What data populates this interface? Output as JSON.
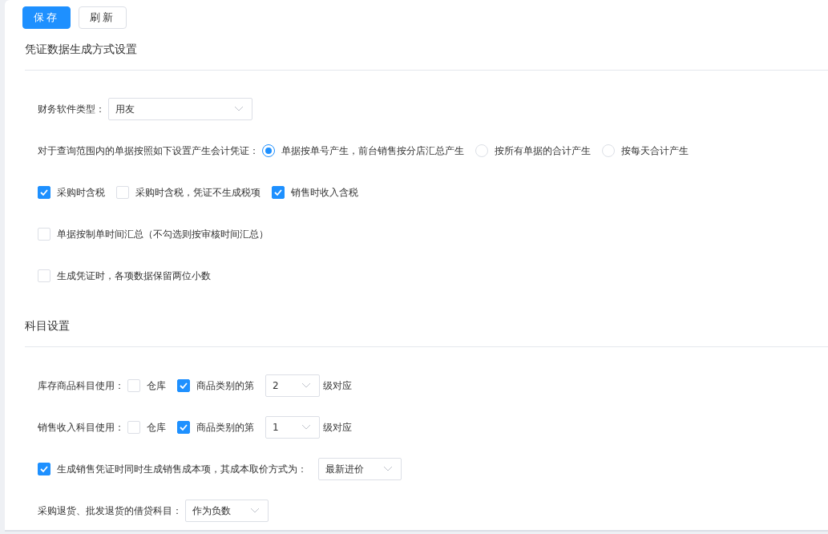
{
  "toolbar": {
    "buttons": [
      {
        "label": "保存",
        "kind": "primary"
      },
      {
        "label": "刷新",
        "kind": "default"
      }
    ]
  },
  "sections": [
    {
      "title": "凭证数据生成方式设置",
      "rows": [
        {
          "parts": [
            {
              "kind": "text",
              "text": "财务软件类型："
            },
            {
              "kind": "select",
              "value": "用友"
            }
          ]
        },
        {
          "parts": [
            {
              "kind": "text",
              "text": "对于查询范围内的单据按照如下设置产生会计凭证："
            },
            {
              "kind": "radio",
              "label": "单据按单号产生，前台销售按分店汇总产生",
              "selected": true
            },
            {
              "kind": "radio",
              "label": "按所有单据的合计产生",
              "selected": false
            },
            {
              "kind": "radio",
              "label": "按每天合计产生",
              "selected": false
            }
          ]
        },
        {
          "parts": [
            {
              "kind": "checkbox",
              "label": "采购时含税",
              "checked": true
            },
            {
              "kind": "checkbox",
              "label": "采购时含税，凭证不生成税项",
              "checked": false
            },
            {
              "kind": "checkbox",
              "label": "销售时收入含税",
              "checked": true
            }
          ]
        },
        {
          "parts": [
            {
              "kind": "checkbox",
              "label": "单据按制单时间汇总（不勾选则按审核时间汇总）",
              "checked": false
            }
          ]
        },
        {
          "parts": [
            {
              "kind": "checkbox",
              "label": "生成凭证时，各项数据保留两位小数",
              "checked": false
            }
          ]
        }
      ]
    },
    {
      "title": "科目设置",
      "rows": [
        {
          "parts": [
            {
              "kind": "text",
              "text": "库存商品科目使用："
            },
            {
              "kind": "checkbox",
              "label": "仓库",
              "checked": false
            },
            {
              "kind": "checkbox",
              "label": "商品类别的第",
              "checked": true
            },
            {
              "kind": "select",
              "value": "2"
            },
            {
              "kind": "text",
              "text": "级对应"
            }
          ]
        },
        {
          "parts": [
            {
              "kind": "text",
              "text": "销售收入科目使用："
            },
            {
              "kind": "checkbox",
              "label": "仓库",
              "checked": false
            },
            {
              "kind": "checkbox",
              "label": "商品类别的第",
              "checked": true
            },
            {
              "kind": "select",
              "value": "1"
            },
            {
              "kind": "text",
              "text": "级对应"
            }
          ]
        },
        {
          "parts": [
            {
              "kind": "checkbox",
              "label": "生成销售凭证时同时生成销售成本项，其成本取价方式为：",
              "checked": true
            },
            {
              "kind": "select",
              "value": "最新进价"
            }
          ]
        },
        {
          "parts": [
            {
              "kind": "text",
              "text": "采购退货、批发退货的借贷科目："
            },
            {
              "kind": "select",
              "value": "作为负数"
            }
          ]
        }
      ]
    }
  ]
}
